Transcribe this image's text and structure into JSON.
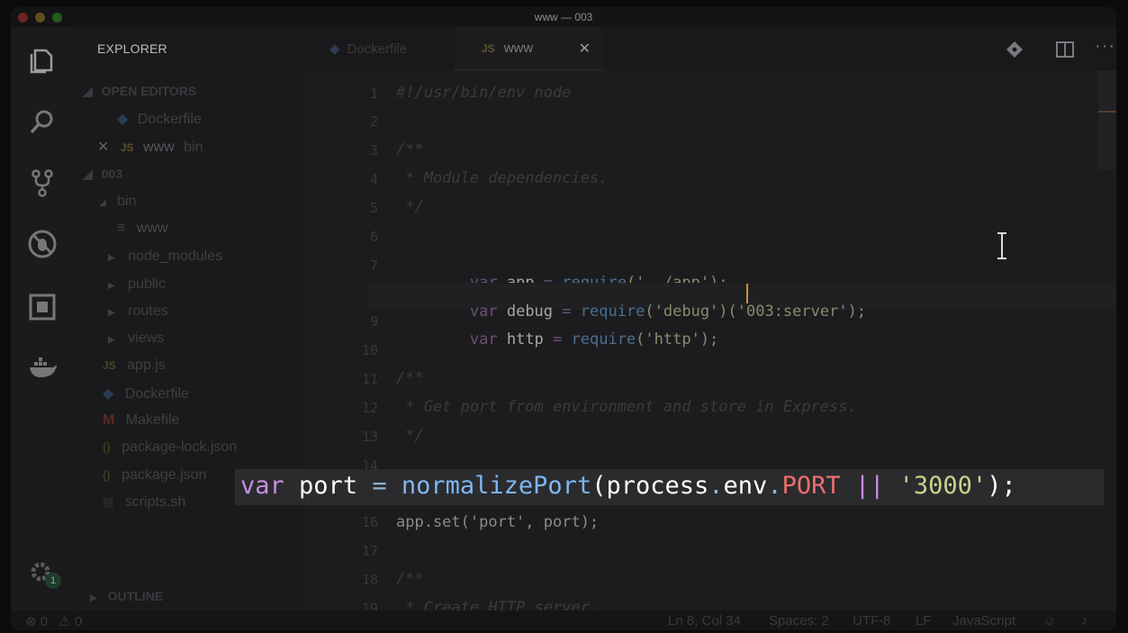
{
  "window": {
    "title": "www — 003"
  },
  "sidebar": {
    "title": "EXPLORER",
    "open_editors_label": "OPEN EDITORS",
    "open_editors": [
      {
        "name": "Dockerfile",
        "icon": "docker-icon"
      },
      {
        "name": "www",
        "detail": "bin",
        "icon": "js-icon",
        "close": "✕"
      }
    ],
    "folder_label": "003",
    "tree": [
      {
        "name": "bin",
        "type": "folder-open"
      },
      {
        "name": "www",
        "type": "file"
      },
      {
        "name": "node_modules",
        "type": "folder"
      },
      {
        "name": "public",
        "type": "folder"
      },
      {
        "name": "routes",
        "type": "folder"
      },
      {
        "name": "views",
        "type": "folder"
      },
      {
        "name": "app.js",
        "type": "js"
      },
      {
        "name": "Dockerfile",
        "type": "docker"
      },
      {
        "name": "Makefile",
        "type": "make"
      },
      {
        "name": "package-lock.json",
        "type": "json"
      },
      {
        "name": "package.json",
        "type": "json"
      },
      {
        "name": "scripts.sh",
        "type": "shell"
      }
    ],
    "outline_label": "OUTLINE",
    "settings_badge": "1"
  },
  "tabs": [
    {
      "label": "Dockerfile",
      "icon": "docker-icon",
      "active": false
    },
    {
      "label": "www",
      "icon": "js-icon",
      "active": true,
      "close": "✕"
    }
  ],
  "editor": {
    "line_numbers": [
      "1",
      "2",
      "3",
      "4",
      "5",
      "6",
      "7",
      "8",
      "9",
      "10",
      "11",
      "12",
      "13",
      "14",
      "15",
      "16",
      "17",
      "18",
      "19"
    ],
    "lines": {
      "l1": "#!/usr/bin/env node",
      "l3": "/**",
      "l4": " * Module dependencies.",
      "l5": " */",
      "l7_kw": "var",
      "l7_name": " app ",
      "l7_eq": "= ",
      "l7_fn": "require",
      "l7_arg": "('../app');",
      "l8_kw": "var",
      "l8_name": " debug ",
      "l8_eq": "= ",
      "l8_fn": "require",
      "l8_arg": "('debug')('003:server');",
      "l9_kw": "var",
      "l9_name": " http ",
      "l9_eq": "= ",
      "l9_fn": "require",
      "l9_arg": "('http');",
      "l11": "/**",
      "l12": " * Get port from environment and store in Express.",
      "l13": " */",
      "l16": "app.set('port', port);",
      "l18": "/**",
      "l19": " * Create HTTP server."
    },
    "zoom": {
      "kw": "var",
      "name": "port",
      "eq": "=",
      "fn": "normalizePort",
      "paren_open": "(",
      "obj": "process",
      "dot1": ".",
      "prop": "env",
      "dot2": ".",
      "const": "PORT",
      "or": "||",
      "str": "'3000'",
      "end": ");"
    }
  },
  "status": {
    "errors": "0",
    "warnings": "0",
    "position": "Ln 8, Col 34",
    "spaces": "Spaces: 2",
    "encoding": "UTF-8",
    "eol": "LF",
    "language": "JavaScript"
  },
  "colors": {
    "traffic_close": "#ed5f56",
    "traffic_min": "#e0c03a",
    "traffic_max": "#52c13f",
    "accent_tab": "#2d2d30"
  }
}
